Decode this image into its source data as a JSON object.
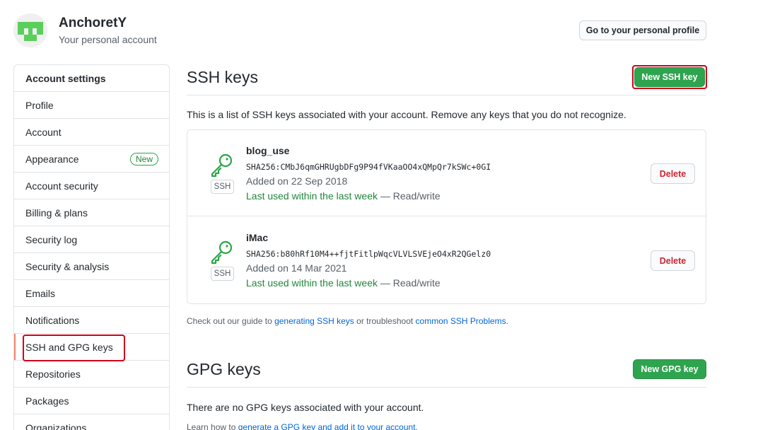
{
  "account": {
    "name": "AnchoretY",
    "subtitle": "Your personal account",
    "profile_button": "Go to your personal profile"
  },
  "sidebar": {
    "heading": "Account settings",
    "items": [
      {
        "label": "Profile"
      },
      {
        "label": "Account"
      },
      {
        "label": "Appearance",
        "badge": "New"
      },
      {
        "label": "Account security"
      },
      {
        "label": "Billing & plans"
      },
      {
        "label": "Security log"
      },
      {
        "label": "Security & analysis"
      },
      {
        "label": "Emails"
      },
      {
        "label": "Notifications"
      },
      {
        "label": "SSH and GPG keys"
      },
      {
        "label": "Repositories"
      },
      {
        "label": "Packages"
      },
      {
        "label": "Organizations"
      }
    ]
  },
  "ssh": {
    "title": "SSH keys",
    "new_button": "New SSH key",
    "description": "This is a list of SSH keys associated with your account. Remove any keys that you do not recognize.",
    "keys": [
      {
        "title": "blog_use",
        "fingerprint": "SHA256:CMbJ6qmGHRUgbDFg9P94fVKaaOO4xQMpQr7kSWc+0GI",
        "added": "Added on 22 Sep 2018",
        "last_used": "Last used within the last week",
        "access": " — Read/write",
        "type_label": "SSH",
        "delete_label": "Delete"
      },
      {
        "title": "iMac",
        "fingerprint": "SHA256:b80hRf10M4++fjtFitlpWqcVLVLSVEjeO4xR2QGelz0",
        "added": "Added on 14 Mar 2021",
        "last_used": "Last used within the last week",
        "access": " — Read/write",
        "type_label": "SSH",
        "delete_label": "Delete"
      }
    ],
    "guide_prefix": "Check out our guide to ",
    "guide_link": "generating SSH keys",
    "guide_middle": " or troubleshoot ",
    "guide_link2": "common SSH Problems",
    "guide_suffix": "."
  },
  "gpg": {
    "title": "GPG keys",
    "new_button": "New GPG key",
    "description": "There are no GPG keys associated with your account.",
    "learn_prefix": "Learn how to ",
    "learn_link": "generate a GPG key and add it to your account",
    "learn_suffix": "."
  },
  "colors": {
    "primary_green": "#2ea44f",
    "link_blue": "#0366d6",
    "danger_red": "#cb2431",
    "annotation_red": "#d0021b",
    "active_orange": "#f9826c"
  }
}
